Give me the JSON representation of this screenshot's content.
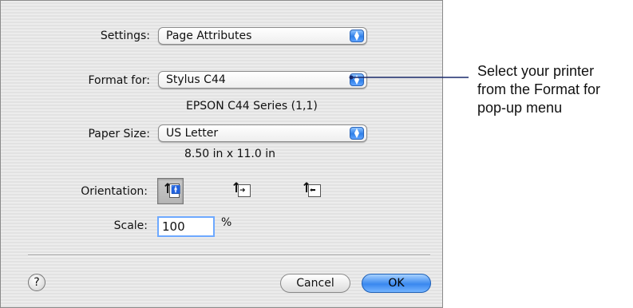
{
  "dialog": {
    "settings": {
      "label": "Settings:",
      "value": "Page Attributes"
    },
    "format_for": {
      "label": "Format for:",
      "value": "Stylus C44",
      "description": "EPSON C44 Series (1,1)"
    },
    "paper_size": {
      "label": "Paper Size:",
      "value": "US Letter",
      "dimensions": "8.50 in x 11.0 in"
    },
    "orientation": {
      "label": "Orientation:",
      "options": [
        "portrait",
        "landscape",
        "landscape-reversed"
      ],
      "selected": "portrait"
    },
    "scale": {
      "label": "Scale:",
      "value": "100",
      "unit": "%"
    },
    "buttons": {
      "help": "?",
      "cancel": "Cancel",
      "ok": "OK"
    }
  },
  "callout": {
    "lines": [
      "Select your printer",
      "from the Format for",
      "pop-up menu"
    ]
  },
  "colors": {
    "accent": "#3a88ef",
    "focus": "#6ea9ff",
    "callout_line": "#1a2a6b"
  }
}
